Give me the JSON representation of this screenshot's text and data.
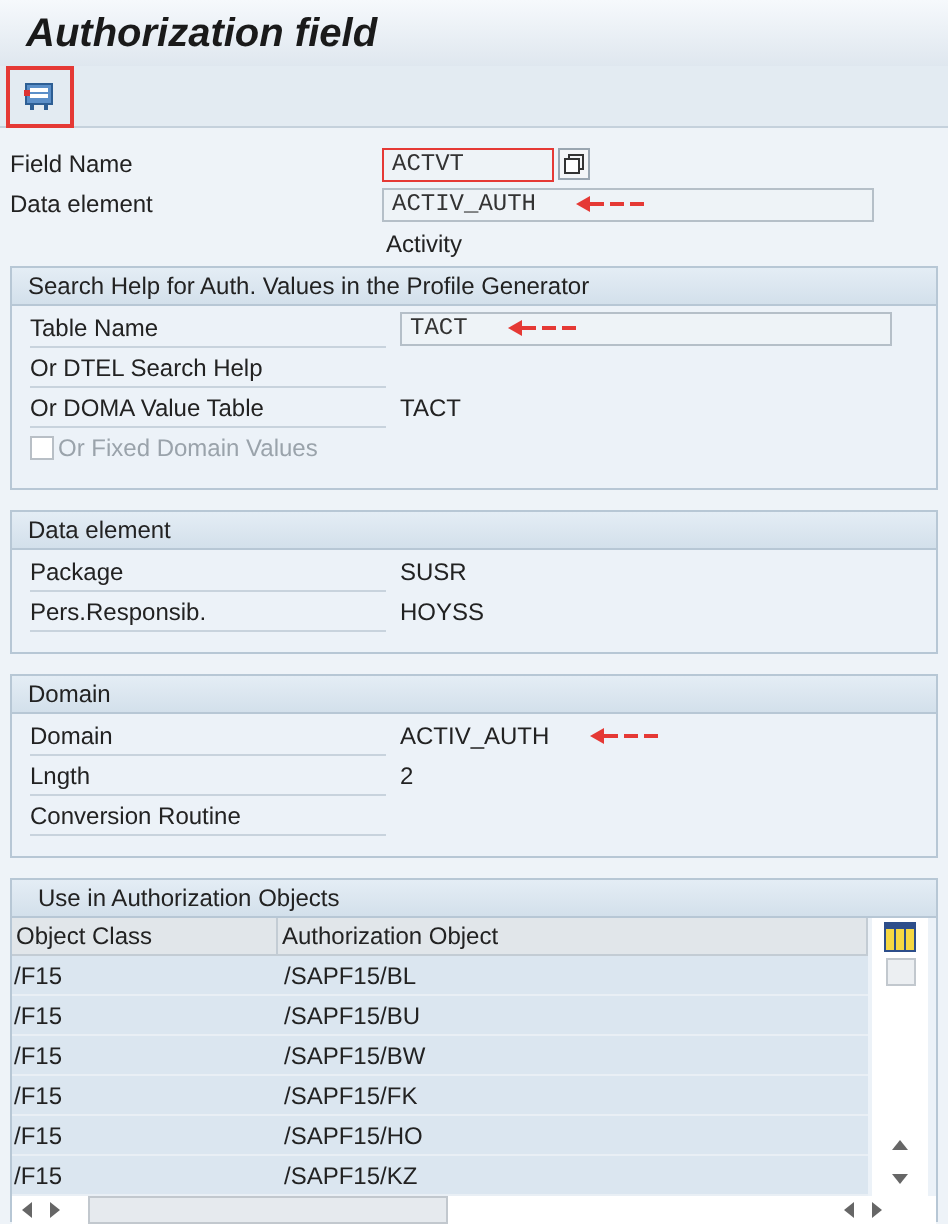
{
  "title": "Authorization field",
  "toolbar": {
    "annotated": true
  },
  "fields": [
    {
      "label": "Field Name",
      "value": "ACTVT",
      "kind": "input",
      "annotated": true
    },
    {
      "label": "Data element",
      "value": "ACTIV_AUTH",
      "kind": "wide-input",
      "arrow": true
    }
  ],
  "description": "Activity",
  "groups": [
    {
      "title": "Search Help for Auth. Values in the Profile Generator",
      "rows": [
        {
          "kind": "wide-input",
          "label": "Table Name",
          "value": "TACT",
          "arrow": true
        },
        {
          "kind": "text",
          "label": "Or DTEL Search Help"
        },
        {
          "kind": "text",
          "label": "Or DOMA Value Table",
          "value": "TACT"
        },
        {
          "kind": "checkbox",
          "label": "Or Fixed Domain Values",
          "checked": false,
          "disabled": true
        }
      ]
    },
    {
      "title": "Data element",
      "rows": [
        {
          "kind": "text",
          "label": "Package",
          "value": "SUSR"
        },
        {
          "kind": "text",
          "label": "Pers.Responsib.",
          "value": "HOYSS"
        }
      ]
    },
    {
      "title": "Domain",
      "rows": [
        {
          "kind": "text",
          "label": "Domain",
          "value": "ACTIV_AUTH",
          "arrow": true
        },
        {
          "kind": "text",
          "label": "Lngth",
          "value": "2"
        },
        {
          "kind": "text",
          "label": "Conversion Routine"
        }
      ]
    }
  ],
  "objects": {
    "title": "Use in Authorization Objects",
    "columns": [
      "Object Class",
      "Authorization Object"
    ],
    "rows": [
      [
        "/F15",
        "/SAPF15/BL"
      ],
      [
        "/F15",
        "/SAPF15/BU"
      ],
      [
        "/F15",
        "/SAPF15/BW"
      ],
      [
        "/F15",
        "/SAPF15/FK"
      ],
      [
        "/F15",
        "/SAPF15/HO"
      ],
      [
        "/F15",
        "/SAPF15/KZ"
      ]
    ]
  }
}
